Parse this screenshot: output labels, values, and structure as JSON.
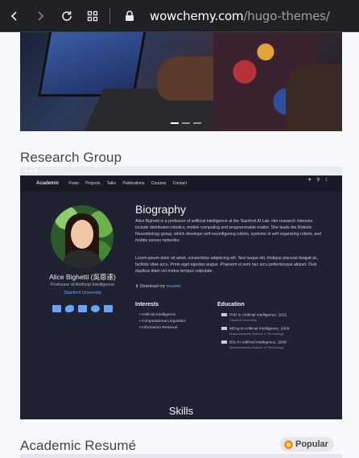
{
  "browser": {
    "url_domain": "wowchemy.com",
    "url_path": "/hugo-themes/",
    "icons": [
      "back-arrow-icon",
      "forward-arrow-icon",
      "reload-icon",
      "tabs-grid-icon",
      "lock-icon"
    ]
  },
  "sections": {
    "research_group": "Research Group",
    "academic_resume": "Academic Resumé",
    "popular_badge": "Popular",
    "popular_icon": "collision-icon"
  },
  "preview": {
    "nav": {
      "brand": "Academic",
      "links": [
        "Posts",
        "Projects",
        "Talks",
        "Publications",
        "Courses",
        "Contact"
      ]
    },
    "profile": {
      "name": "Alice Bighetti (吳恩達)",
      "role": "Professor of Artificial Intelligence",
      "organization": "Stanford University",
      "social_icons": [
        "envelope-icon",
        "twitter-icon",
        "graduation-cap-icon",
        "github-icon",
        "linkedin-icon"
      ]
    },
    "biography": {
      "title": "Biography",
      "paragraph1": "Alice Bighetti is a professor of artificial intelligence at the Stanford AI Lab. Her research interests include distributed robotics, mobile computing and programmable matter. She leads the Robotic Neurobiology group, which develops self-reconfiguring robots, systems of self-organizing robots, and mobile sensor networks.",
      "paragraph2": "Lorem ipsum dolor sit amet, consectetur adipiscing elit. Sed neque elit, tristique placerat feugiat ac, facilisis vitae arcu. Proin eget egestas augue. Praesent ut sem nec arcu pellentesque aliquet. Duis dapibus diam vel metus tempus vulputate.",
      "download_prefix": "Download my",
      "download_link": "resumé."
    },
    "interests": {
      "title": "Interests",
      "items": [
        "Artificial Intelligence",
        "Computational Linguistics",
        "Information Retrieval"
      ]
    },
    "education": {
      "title": "Education",
      "items": [
        {
          "degree": "PhD in Artificial Intelligence, 2012",
          "school": "Stanford University"
        },
        {
          "degree": "MEng in Artificial Intelligence, 2009",
          "school": "Massachusetts Institute of Technology"
        },
        {
          "degree": "BSc in Artificial Intelligence, 2008",
          "school": "Massachusetts Institute of Technology"
        }
      ]
    },
    "skills_title": "Skills"
  }
}
